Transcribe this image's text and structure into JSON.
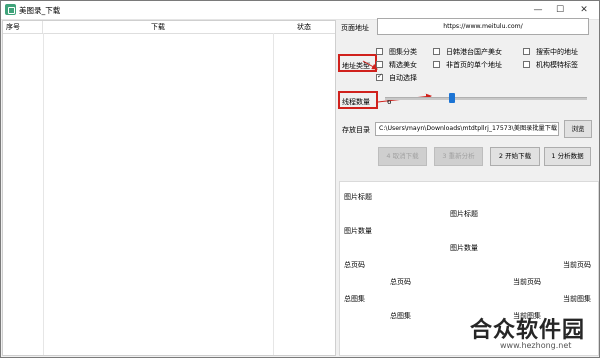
{
  "window": {
    "title": "美图录_下载",
    "minimize": "—",
    "maximize": "☐",
    "close": "✕"
  },
  "list": {
    "columns": [
      "序号",
      "下载",
      "状态"
    ]
  },
  "form": {
    "url_label": "页面地址",
    "url_value": "https://www.meitulu.com/",
    "addr_type_label": "地址类型",
    "options": [
      {
        "label": "图集分类",
        "checked": false
      },
      {
        "label": "日韩港台国产美女",
        "checked": false
      },
      {
        "label": "搜索中的地址",
        "checked": false
      },
      {
        "label": "精选美女",
        "checked": false
      },
      {
        "label": "非首页的单个地址",
        "checked": false
      },
      {
        "label": "机构模特标签",
        "checked": false
      },
      {
        "label": "自动选择",
        "checked": true
      }
    ],
    "thread_label": "线程数量",
    "thread_value": "6",
    "thread_fraction": 0.33,
    "dir_label": "存放目录",
    "dir_value": "C:\\Users\\mayn\\Downloads\\mtdtpllrj_17573\\美图录批量下载",
    "browse_label": "浏览"
  },
  "actions": {
    "cancel": "4 取消下载",
    "reanalyze": "3 重新分析",
    "start": "2 开始下载",
    "analyze": "1 分析数据"
  },
  "info": {
    "album_title_label": "图片标题",
    "album_title_value": "图片标题",
    "image_count_label": "图片数量",
    "image_count_value": "图片数量",
    "total_pages_label": "总页码",
    "total_pages_value": "总页码",
    "current_page_label": "当前页码",
    "current_page_value": "当前页码",
    "total_albums_label": "总图集",
    "total_albums_value": "总图集",
    "current_album_label": "当前图集",
    "current_album_value": "当前图集"
  },
  "watermark": {
    "text": "合众软件园",
    "url": "www.hezhong.net"
  },
  "accent": {
    "red": "#d0211c",
    "slider": "#1c74d4"
  }
}
